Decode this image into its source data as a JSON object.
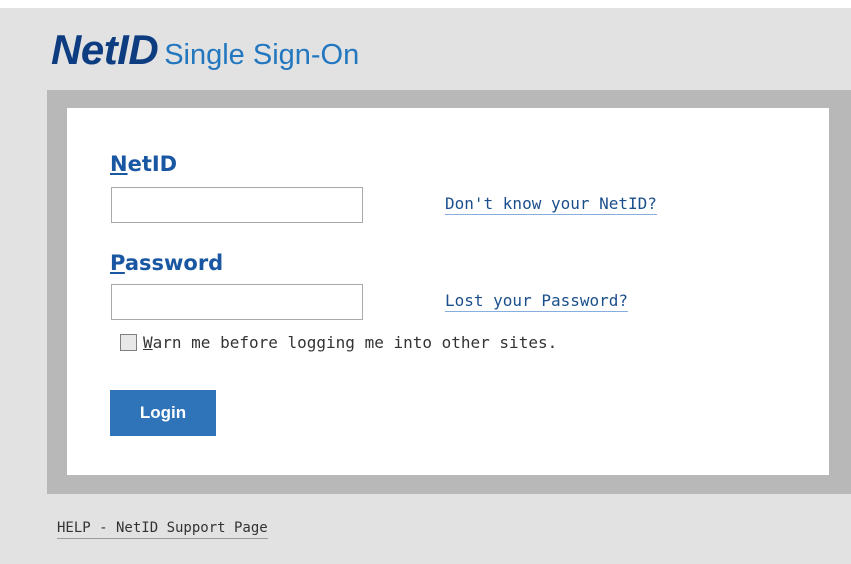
{
  "header": {
    "brand": "NetID",
    "subtitle": "Single Sign-On"
  },
  "form": {
    "netid": {
      "label_accel": "N",
      "label_rest": "etID",
      "value": "",
      "help_link": "Don't know your NetID?"
    },
    "password": {
      "label_accel": "P",
      "label_rest": "assword",
      "value": "",
      "help_link": "Lost your Password?"
    },
    "warn": {
      "accel": "W",
      "rest": "arn me before logging me into other sites.",
      "checked": false
    },
    "login_label": "Login"
  },
  "footer": {
    "help_link": "HELP - NetID Support Page"
  },
  "colors": {
    "background": "#e2e2e2",
    "frame": "#b8b8b8",
    "brand": "#0d3d80",
    "accent": "#2f74b9",
    "link": "#1b4f8c"
  }
}
